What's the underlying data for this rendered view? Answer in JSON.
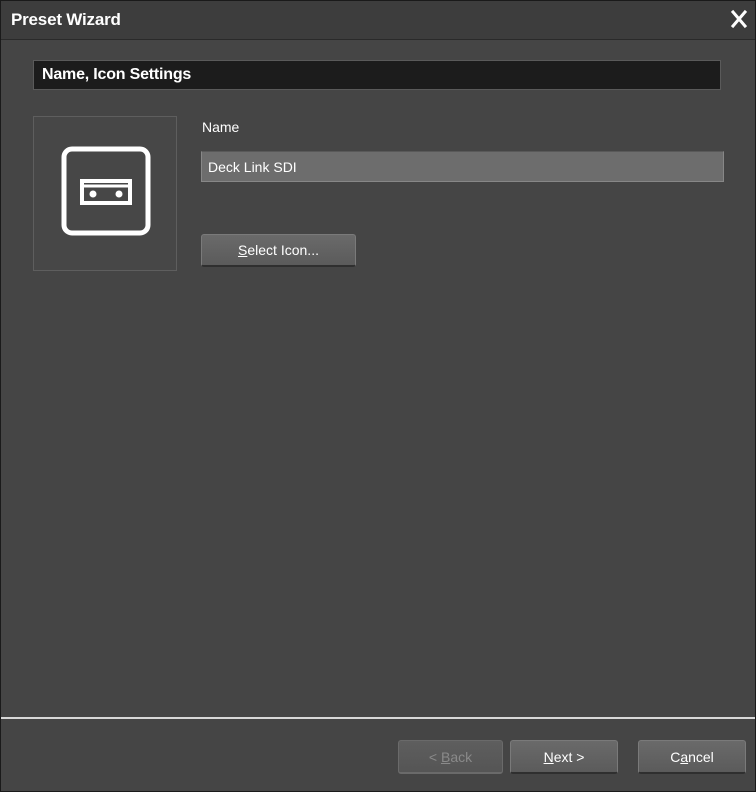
{
  "window": {
    "title": "Preset Wizard",
    "close_icon": "close-x-icon"
  },
  "section": {
    "title": "Name, Icon Settings"
  },
  "preset_icon": {
    "icon": "deck-device-icon"
  },
  "name_field": {
    "label": "Name",
    "value": "Deck Link SDI"
  },
  "select_icon_button": {
    "mnemonic": "S",
    "rest": "elect Icon..."
  },
  "footer": {
    "back": {
      "prefix": "< ",
      "mnemonic": "B",
      "rest": "ack",
      "enabled": false
    },
    "next": {
      "prefix": "",
      "mnemonic": "N",
      "rest": "ext >",
      "enabled": true
    },
    "cancel": {
      "prefix": "C",
      "mnemonic": "a",
      "rest": "ncel",
      "enabled": true
    }
  },
  "colors": {
    "window_bg": "#454545",
    "header_bg": "#1c1c1c",
    "input_bg": "#6d6d6d",
    "button_bg": "#626262",
    "divider": "#d8d8d8",
    "text": "#ffffff",
    "disabled_text": "#8a8a8a"
  }
}
